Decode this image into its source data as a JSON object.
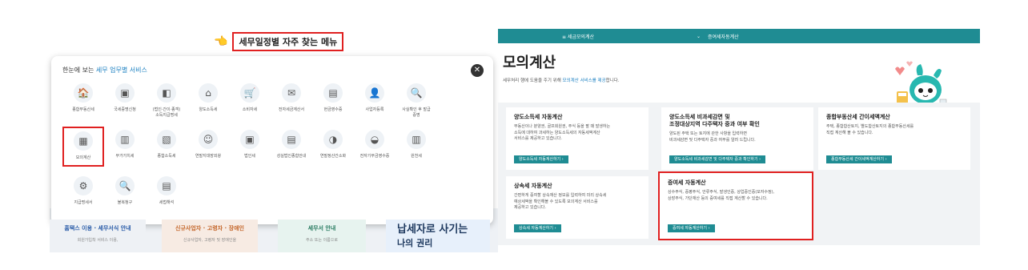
{
  "left": {
    "promo_title": "세무일정별 자주 찾는 메뉴",
    "popup": {
      "header_prefix": "한눈에 보는 ",
      "header_highlight": "세무 업무별 서비스",
      "close_symbol": "✕",
      "items": [
        {
          "label": "종합부동산세",
          "icon": "🏠"
        },
        {
          "label": "국세증명신청",
          "icon": "▣"
        },
        {
          "label": "(법인·간이·종객)\n소득지급명세",
          "icon": "◧"
        },
        {
          "label": "양도소득세",
          "icon": "⌂"
        },
        {
          "label": "소비자세",
          "icon": "🛒"
        },
        {
          "label": "전자세금계산서",
          "icon": "✉"
        },
        {
          "label": "현금영수증",
          "icon": "▤"
        },
        {
          "label": "사업자등록",
          "icon": "👤"
        },
        {
          "label": "사실확인 후 발급\n증명",
          "icon": "🔍"
        },
        {
          "label": "",
          "icon": ""
        },
        {
          "label": "모의계산",
          "icon": "▦",
          "selected": true
        },
        {
          "label": "부가가치세",
          "icon": "▥"
        },
        {
          "label": "종합소득세",
          "icon": "▧"
        },
        {
          "label": "연말지대장외왕",
          "icon": "☺"
        },
        {
          "label": "법인세",
          "icon": "▣"
        },
        {
          "label": "성실법인종합안내",
          "icon": "▤"
        },
        {
          "label": "연말정산간소화",
          "icon": "◑"
        },
        {
          "label": "전자기부금영수증",
          "icon": "◒"
        },
        {
          "label": "원천세",
          "icon": "▥"
        },
        {
          "label": "",
          "icon": ""
        },
        {
          "label": "지급명세서",
          "icon": "⚙"
        },
        {
          "label": "불복청구",
          "icon": "🔍"
        },
        {
          "label": "세법해석",
          "icon": "▤"
        }
      ]
    },
    "cards": [
      {
        "title": "홈택스 이용 · 세무서식 안내",
        "sub": "회원가입착 서비스 이용,"
      },
      {
        "title": "신규사업자 · 고령자 · 장애인",
        "sub": "신규사업자, 고령자 및 장애인을"
      },
      {
        "title": "세무서 안내",
        "sub": "주소 또는 이름으로"
      },
      {
        "title1": "납세자로 사기는",
        "title2": "나의 권리"
      }
    ]
  },
  "right": {
    "topbar": {
      "menu1": "≡  세금모의계산",
      "chevron": "⌄",
      "menu2": "증여세자동계산"
    },
    "title": "모의계산",
    "desc_prefix": "세무처리 행에 도움을 주기 위해 ",
    "desc_highlight": "모의계산 서비스를 제공",
    "desc_suffix": "합니다.",
    "services": [
      {
        "title": "양도소득세 자동계산",
        "desc": "부동산이나 분양권, 골프회원권, 주식 등을 팔 때 발생하는\n소득에 대하여 과세하는 양도소득세의 자동세액계산\n서비스를 제공하고 있습니다.",
        "button": "양도소득세 자동계산하기  ›"
      },
      {
        "title": "양도소득세 비과세감면 및\n조정대상지역 다주택자 중과 여부 확인",
        "desc": "양도된 주택 또는 토지에 관한 사항을 입력하면\n비과세감면 및 다주택자 중과 여부를 알려 드립니다.",
        "button": "양도소득세 비과세감면 및 다주택자 중과 확인하기  ›"
      },
      {
        "title": "종합부동산세 간이세액계산",
        "desc": "주택, 종합합산토지, 별도합산토지의 종합부동산세를\n직접 계산해 볼 수 있습니다.",
        "button": "종합부동산세 간이세액계산하기  ›"
      },
      {
        "title": "상속세 자동계산",
        "desc": "간편하게 증여할 상속재산 정보를 입력하여 미리 상속세\n예상세액을 확인해볼 수 있도록 모의계산 서비스를\n제공하고 있습니다.",
        "button": "상속세 자동계산하기  ›"
      },
      {
        "title": "증여세 자동계산",
        "desc": "상수주식, 증평주식, 안류주식, 발생인증, 상업증인증(모자수정),\n상장주식, 가단재산 등의 증여세를 직접 계산할 수 있습니다.",
        "button": "증여세 자동계산하기  ›"
      }
    ]
  }
}
